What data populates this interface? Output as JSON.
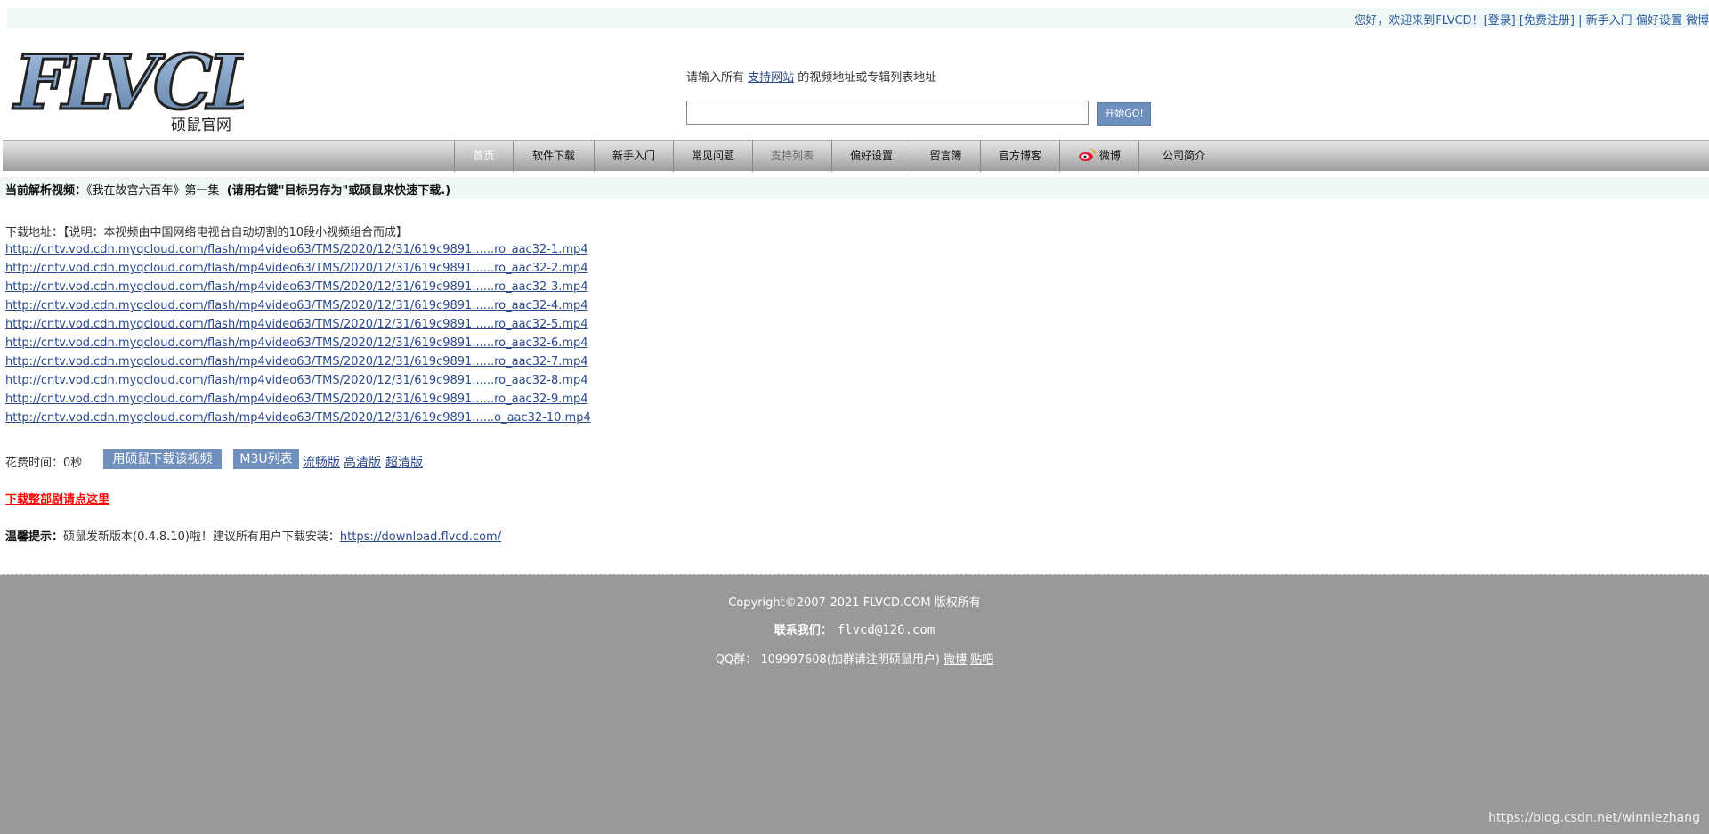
{
  "topbar": {
    "welcome": "您好，欢迎来到FLVCD！",
    "login": "[登录]",
    "register": "[免费注册]",
    "sep": " | ",
    "newbie": "新手入门",
    "prefs": "偏好设置",
    "weibo": "微博"
  },
  "logo": {
    "text": "FLVCD",
    "sub": "硕鼠官网"
  },
  "search": {
    "hint_pre": "请输入所有 ",
    "hint_link": "支持网站",
    "hint_post": " 的视频地址或专辑列表地址",
    "value": "",
    "placeholder": "",
    "go_label": "开始GO!"
  },
  "nav": {
    "items": [
      {
        "label": "首页"
      },
      {
        "label": "软件下载"
      },
      {
        "label": "新手入门"
      },
      {
        "label": "常见问题"
      },
      {
        "label": "支持列表"
      },
      {
        "label": "偏好设置"
      },
      {
        "label": "留言簿"
      },
      {
        "label": "官方博客"
      },
      {
        "label": "微博"
      },
      {
        "label": "公司简介"
      }
    ]
  },
  "current": {
    "label": "当前解析视频：",
    "title": "《我在故宫六百年》第一集",
    "note": "(请用右键\"目标另存为\"或硕鼠来快速下载.)"
  },
  "download": {
    "label": "下载地址：",
    "note": "【说明：本视频由中国网络电视台自动切割的10段小视频组合而成】",
    "links": [
      "http://cntv.vod.cdn.myqcloud.com/flash/mp4video63/TMS/2020/12/31/619c9891......ro_aac32-1.mp4",
      "http://cntv.vod.cdn.myqcloud.com/flash/mp4video63/TMS/2020/12/31/619c9891......ro_aac32-2.mp4",
      "http://cntv.vod.cdn.myqcloud.com/flash/mp4video63/TMS/2020/12/31/619c9891......ro_aac32-3.mp4",
      "http://cntv.vod.cdn.myqcloud.com/flash/mp4video63/TMS/2020/12/31/619c9891......ro_aac32-4.mp4",
      "http://cntv.vod.cdn.myqcloud.com/flash/mp4video63/TMS/2020/12/31/619c9891......ro_aac32-5.mp4",
      "http://cntv.vod.cdn.myqcloud.com/flash/mp4video63/TMS/2020/12/31/619c9891......ro_aac32-6.mp4",
      "http://cntv.vod.cdn.myqcloud.com/flash/mp4video63/TMS/2020/12/31/619c9891......ro_aac32-7.mp4",
      "http://cntv.vod.cdn.myqcloud.com/flash/mp4video63/TMS/2020/12/31/619c9891......ro_aac32-8.mp4",
      "http://cntv.vod.cdn.myqcloud.com/flash/mp4video63/TMS/2020/12/31/619c9891......ro_aac32-9.mp4",
      "http://cntv.vod.cdn.myqcloud.com/flash/mp4video63/TMS/2020/12/31/619c9891......o_aac32-10.mp4"
    ]
  },
  "actions": {
    "time_label": "花费时间：0秒",
    "download_btn": "用硕鼠下载该视频",
    "m3u_btn": "M3U列表",
    "smooth": "流畅版",
    "hd": "高清版",
    "super": "超清版"
  },
  "drama_link": "下载整部剧请点这里",
  "tip": {
    "label": "温馨提示：",
    "text": "硕鼠发新版本(0.4.8.10)啦！建议所有用户下载安装：",
    "link": "https://download.flvcd.com/"
  },
  "footer": {
    "copyright": "Copyright©2007-2021 FLVCD.COM 版权所有",
    "contact_label": "联系我们：",
    "contact_email": "flvcd@126.com",
    "qq": "QQ群： 109997608(加群请注明硕鼠用户) ",
    "weibo": "微博",
    "tieba": "贴吧",
    "watermark": "https://blog.csdn.net/winniezhang"
  },
  "colors": {
    "accent": "#6f90bd",
    "link": "#2b4a8a",
    "footer_bg": "#999999",
    "alert": "#ff0000"
  }
}
